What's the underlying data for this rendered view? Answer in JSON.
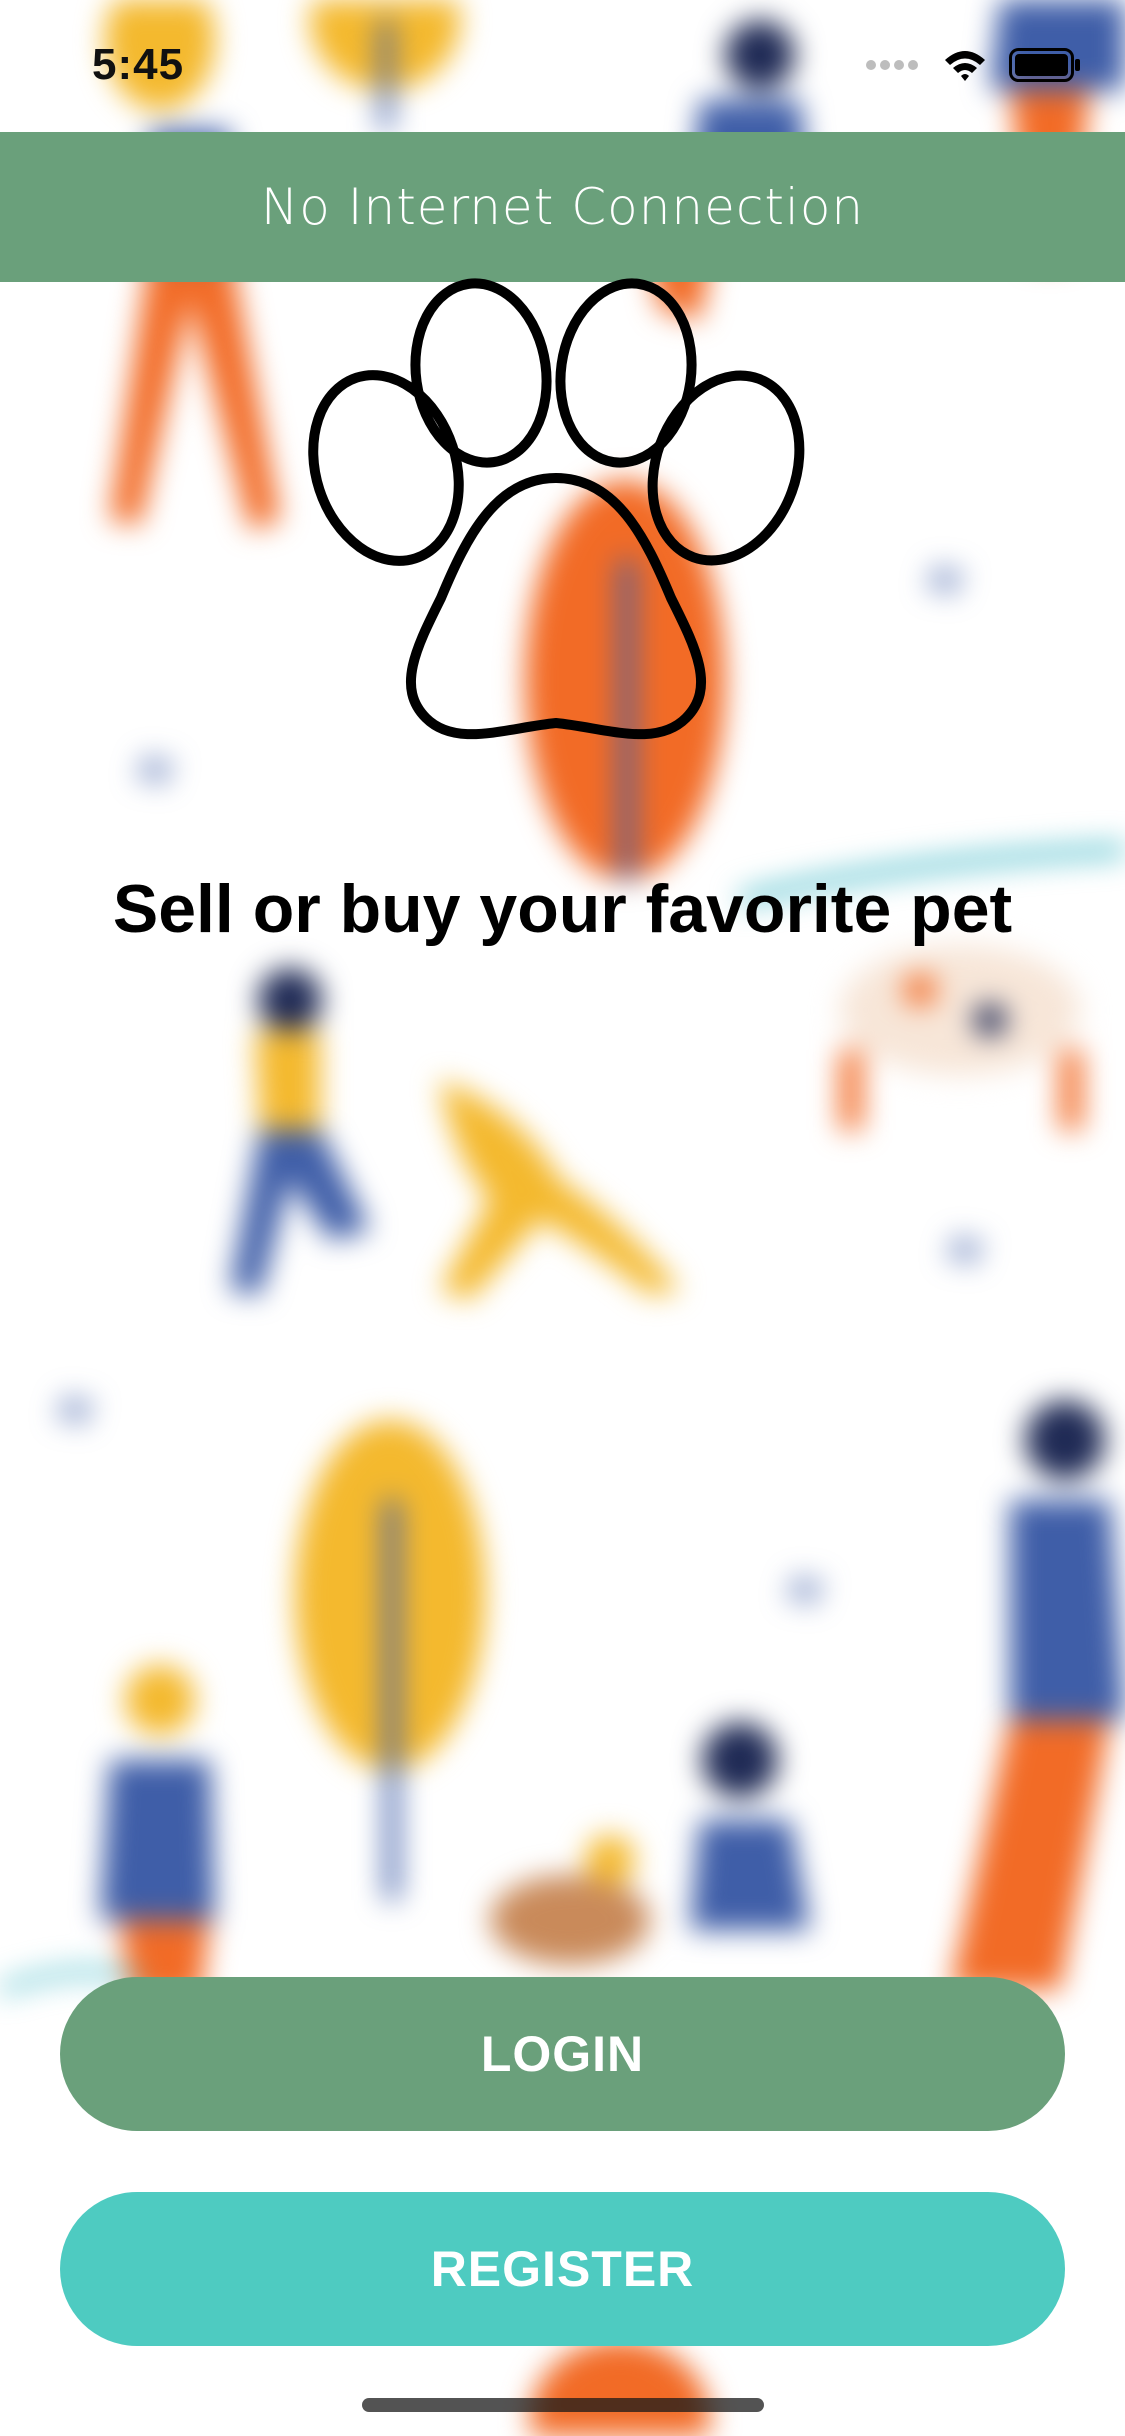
{
  "status_bar": {
    "time": "5:45",
    "icons": [
      "cellular-signal-icon",
      "wifi-icon",
      "battery-icon"
    ]
  },
  "banner": {
    "text": "No Internet Connection",
    "color": "#6aa07b"
  },
  "logo": {
    "icon": "paw-icon"
  },
  "tagline": "Sell or buy your favorite pet",
  "buttons": {
    "login_label": "LOGIN",
    "login_color": "#6aa07b",
    "register_label": "REGISTER",
    "register_color": "#4ecbc1"
  },
  "background": {
    "description_icon": "park-illustration-icon",
    "colors": [
      "#f4b92e",
      "#f26b26",
      "#3f5ea8",
      "#5fc4d0"
    ]
  }
}
